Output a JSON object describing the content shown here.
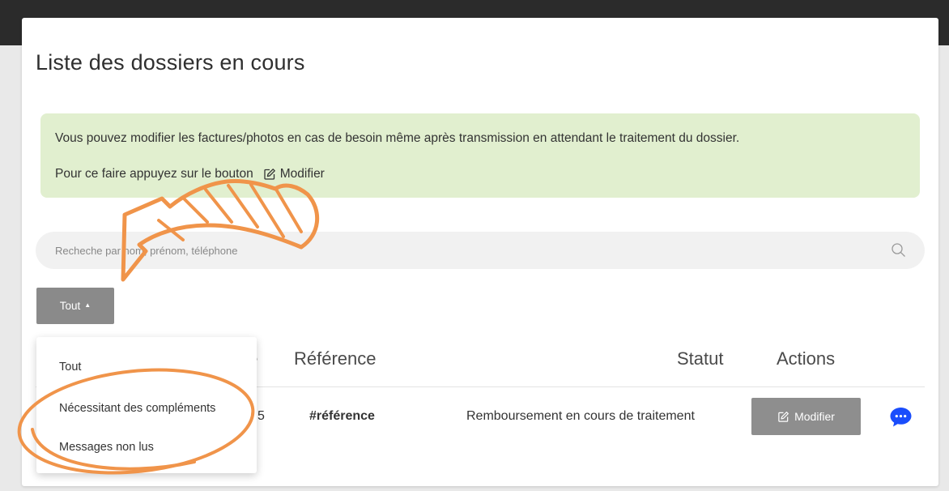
{
  "page": {
    "title": "Liste des dossiers en cours"
  },
  "notice": {
    "line1": "Vous pouvez modifier les factures/photos en cas de besoin même après transmission en attendant le traitement du dossier.",
    "line2_prefix": "Pour ce faire appuyez sur le bouton",
    "line2_button_label": "Modifier"
  },
  "search": {
    "placeholder": "Recheche par nom, prénom, téléphone"
  },
  "filter": {
    "selected_label": "Tout",
    "options": [
      "Tout",
      "Nécessitant des compléments",
      "Messages non lus"
    ]
  },
  "table": {
    "headers": {
      "date_partial": "te",
      "reference": "Référence",
      "status": "Statut",
      "actions": "Actions"
    },
    "rows": [
      {
        "date_partial": "5",
        "reference": "#référence",
        "status": "Remboursement en cours de traitement",
        "action_label": "Modifier"
      }
    ]
  },
  "colors": {
    "notice_bg": "#e1efcf",
    "button_gray": "#8a8a8a",
    "chat_blue": "#1a4dfc",
    "annotation_orange": "#f0944a"
  },
  "icons": {
    "edit": "pencil-square-icon",
    "search": "magnifier-icon",
    "chat": "chat-bubble-icon"
  }
}
